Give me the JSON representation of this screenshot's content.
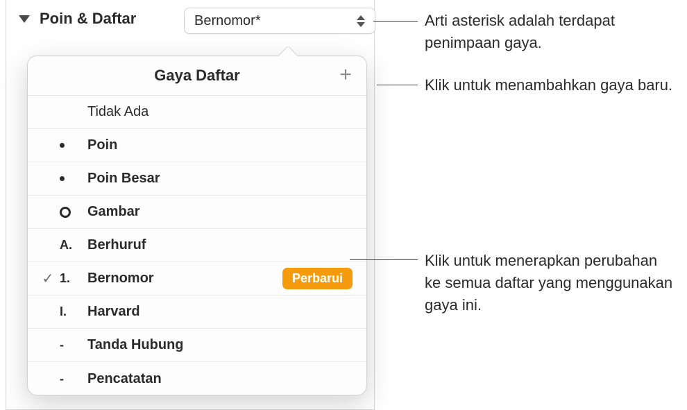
{
  "section": {
    "title": "Poin & Daftar"
  },
  "dropdown": {
    "value": "Bernomor*"
  },
  "popover": {
    "title": "Gaya Daftar",
    "items": [
      {
        "marker": "",
        "label": "Tidak Ada"
      },
      {
        "marker": "dot",
        "label": "Poin"
      },
      {
        "marker": "dot",
        "label": "Poin Besar"
      },
      {
        "marker": "circle",
        "label": "Gambar"
      },
      {
        "marker": "A.",
        "label": "Berhuruf"
      },
      {
        "marker": "1.",
        "label": "Bernomor",
        "selected": true,
        "updateLabel": "Perbarui"
      },
      {
        "marker": "I.",
        "label": "Harvard"
      },
      {
        "marker": "-",
        "label": "Tanda Hubung"
      },
      {
        "marker": "-",
        "label": "Pencatatan"
      }
    ]
  },
  "callouts": {
    "asterisk": "Arti asterisk adalah terdapat penimpaan gaya.",
    "plus": "Klik untuk menambahkan gaya baru.",
    "update": "Klik untuk menerapkan perubahan ke semua daftar yang menggunakan gaya ini."
  }
}
